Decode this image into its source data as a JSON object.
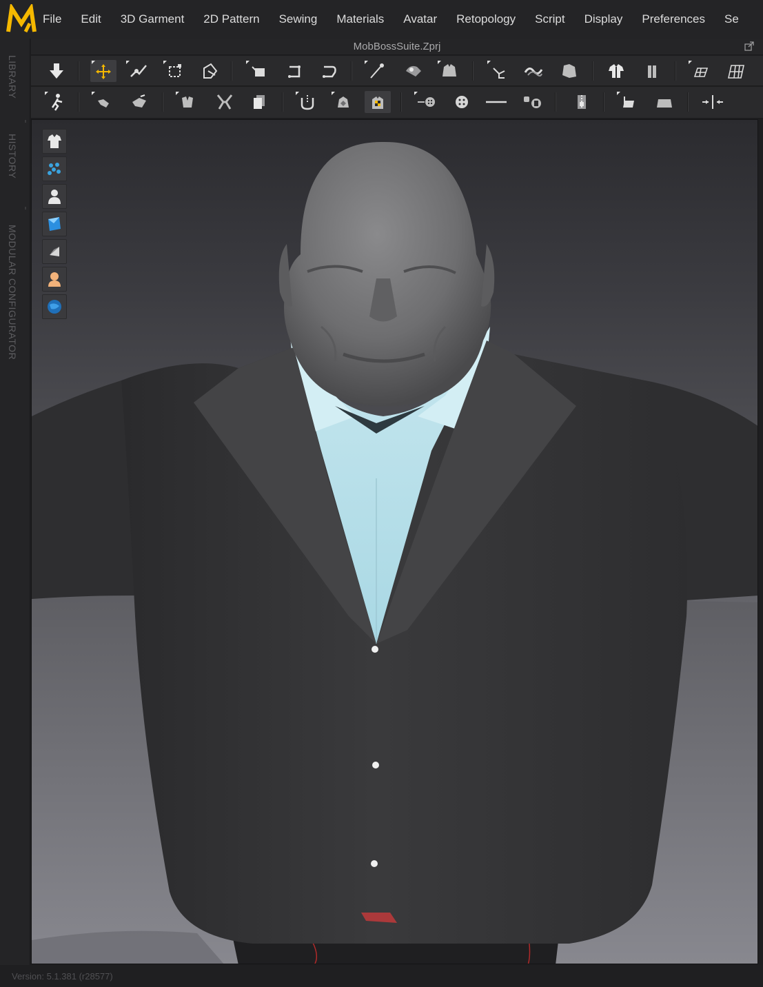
{
  "app": {
    "logo_icon": "md-logo",
    "accent_color": "#f5b800"
  },
  "menu": {
    "items": [
      "File",
      "Edit",
      "3D Garment",
      "2D Pattern",
      "Sewing",
      "Materials",
      "Avatar",
      "Retopology",
      "Script",
      "Display",
      "Preferences",
      "Se"
    ]
  },
  "side_tabs": [
    "LIBRARY",
    "HISTORY",
    "MODULAR CONFIGURATOR"
  ],
  "document": {
    "title": "MobBossSuite.Zprj"
  },
  "toolbar_row1": [
    "simulation-icon",
    "select-move-icon",
    "edit-pattern-icon",
    "transform-pattern-icon",
    "edit-curvature-icon",
    "fold-arrangement-icon",
    "fold-pattern-icon",
    "fold-curve-icon",
    "pin-icon",
    "tack-icon",
    "garment-fit-icon",
    "segment-sewing-icon",
    "free-sewing-icon",
    "check-sewing-icon",
    "shirt-arrangement-icon",
    "avatar-measure-icon",
    "grid-pattern-icon",
    "flatten-grid-icon"
  ],
  "toolbar_row2": [
    "pose-avatar-icon",
    "edit-avatar-icon",
    "reshape-avatar-icon",
    "edit-garment-icon",
    "select-mesh-icon",
    "fabric-texture-icon",
    "topstitch-icon",
    "texture-edit-icon",
    "uv-checker-icon",
    "button-icon",
    "buttonhole-icon",
    "line-icon",
    "lock-button-icon",
    "zipper-icon",
    "puckering-icon",
    "shape-boundary-icon",
    "measure-icon"
  ],
  "quick_tools": [
    "garment-view-icon",
    "particle-view-icon",
    "avatar-view-icon",
    "fabric-view-icon",
    "texture-view-icon",
    "skin-view-icon",
    "environment-view-icon"
  ],
  "status": {
    "version": "Version: 5.1.381 (r28577)"
  }
}
